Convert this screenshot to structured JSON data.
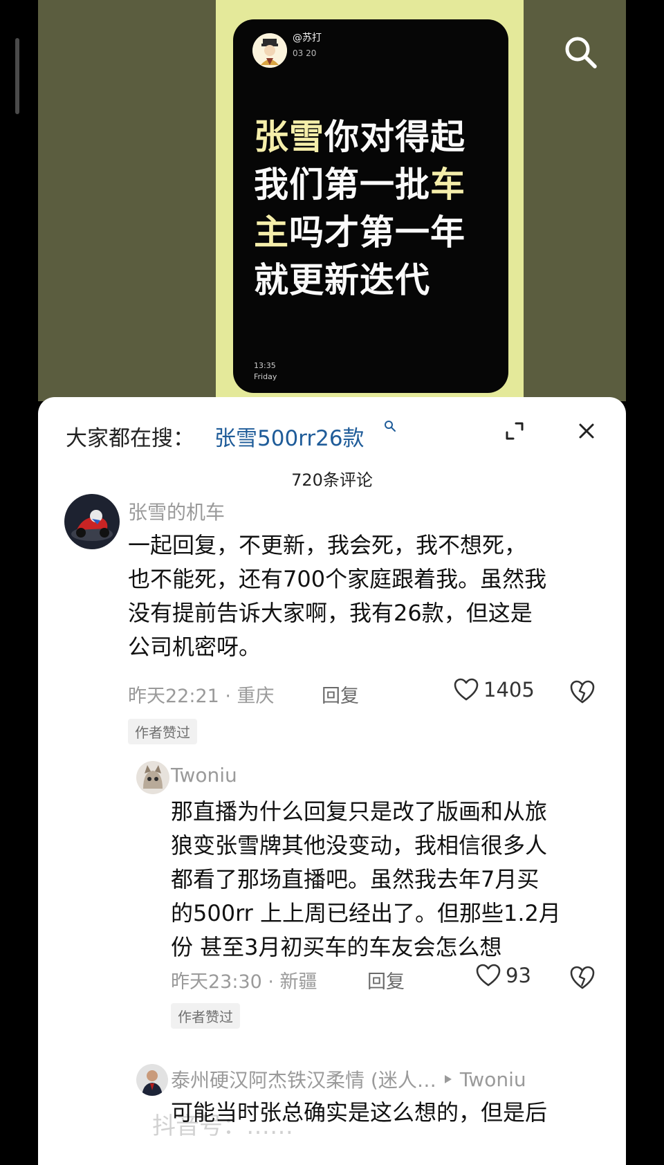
{
  "video": {
    "poster_handle": "@苏打",
    "poster_date": "03 20",
    "poster_lines": [
      {
        "hl": "张雪",
        "rest": "你对得起"
      },
      {
        "pre": "我们第一批",
        "hl": "车"
      },
      {
        "hl": "主",
        "rest": "吗才第一年"
      },
      {
        "pre": "就更新迭代"
      }
    ],
    "poster_time": "13:35",
    "poster_day": "Friday",
    "search_icon": "search-icon"
  },
  "sheet": {
    "hot_prefix": "大家都在搜：",
    "hot_term": "张雪500rr26款",
    "comment_count": "720条评论",
    "comments": [
      {
        "author": "张雪的机车",
        "lines": [
          "一起回复，不更新，我会死，我不想死，",
          "也不能死，还有700个家庭跟着我。虽然我",
          "没有提前告诉大家啊，我有26款，但这是",
          "公司机密呀。"
        ],
        "meta": "昨天22:21 · 重庆",
        "reply_label": "回复",
        "likes": "1405",
        "badge": "作者赞过"
      },
      {
        "author": "Twoniu",
        "lines": [
          "那直播为什么回复只是改了版画和从旅",
          "狼变张雪牌其他没变动，我相信很多人",
          "都看了那场直播吧。虽然我去年7月买",
          "的500rr 上上周已经出了。但那些1.2月",
          "份 甚至3月初买车的车友会怎么想"
        ],
        "meta": "昨天23:30 · 新疆",
        "reply_label": "回复",
        "likes": "93",
        "badge": "作者赞过"
      },
      {
        "author": "泰州硬汉阿杰铁汉柔情 (迷人…",
        "reply_to": "Twoniu",
        "lines": [
          "可能当时张总确实是这么想的，但是后"
        ]
      }
    ],
    "watermark": "抖音号：……"
  },
  "colors": {
    "video_bg": "#5b5d3f",
    "poster_accent": "#f5eeaa",
    "hot_term": "#1f5c99"
  }
}
